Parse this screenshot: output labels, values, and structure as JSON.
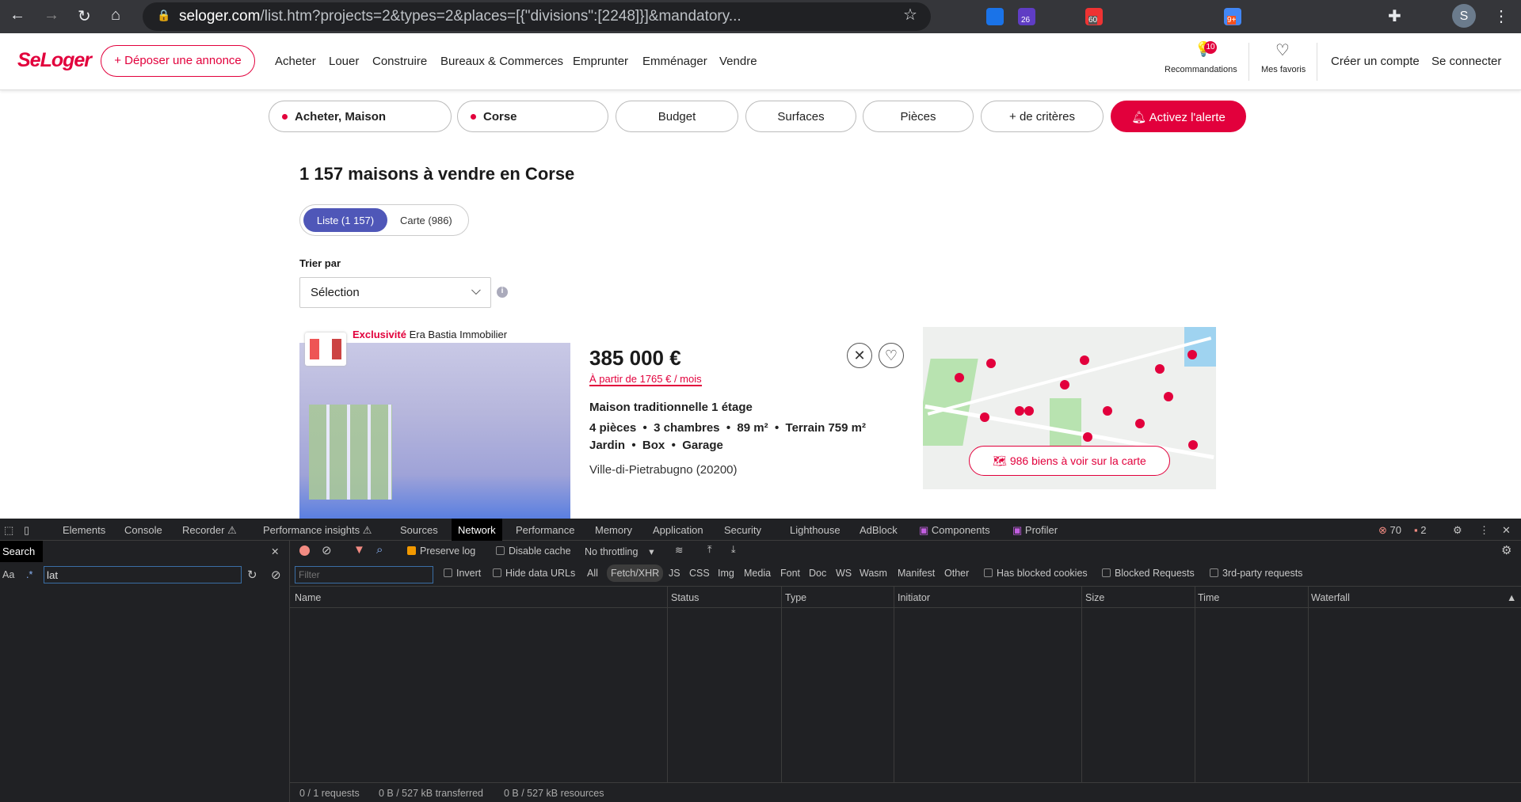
{
  "browser": {
    "url_host": "seloger.com",
    "url_path": "/list.htm?projects=2&types=2&places=[{\"divisions\":[2248]}]&mandatory...",
    "ext_badges": [
      "26",
      "60",
      "9+"
    ],
    "profile_initial": "S"
  },
  "header": {
    "logo": "SeLoger",
    "post_ad": "Déposer une annonce",
    "nav": [
      "Acheter",
      "Louer",
      "Construire",
      "Bureaux & Commerces",
      "Emprunter",
      "Emménager",
      "Vendre"
    ],
    "recommendations": "Recommandations",
    "recommendations_badge": "10",
    "favorites": "Mes favoris",
    "create_account": "Créer un compte",
    "login": "Se connecter"
  },
  "filters": {
    "project": "Acheter, Maison",
    "place": "Corse",
    "budget": "Budget",
    "surfaces": "Surfaces",
    "rooms": "Pièces",
    "more": "+ de critères",
    "alert": "Activez l'alerte"
  },
  "results": {
    "title": "1 157 maisons à vendre en Corse",
    "list_tab": "Liste (1 157)",
    "map_tab": "Carte  (986)",
    "sort_label": "Trier par",
    "sort_value": "Sélection"
  },
  "listing": {
    "exclusive": "Exclusivité",
    "agency": "Era Bastia Immobilier",
    "price": "385 000 €",
    "monthly": "À partir de 1765 € / mois",
    "title": "Maison traditionnelle 1 étage",
    "features": "4 pièces  •  3 chambres  •  89 m²  •  Terrain 759 m²",
    "extras": "Jardin  •  Box  •  Garage",
    "location": "Ville-di-Pietrabugno (20200)"
  },
  "map": {
    "button": "986 biens à voir sur la carte"
  },
  "devtools": {
    "tabs": [
      "Elements",
      "Console",
      "Recorder ⚠",
      "Performance insights ⚠",
      "Sources",
      "Network",
      "Performance",
      "Memory",
      "Application",
      "Security",
      "Lighthouse",
      "AdBlock",
      "Components",
      "Profiler"
    ],
    "errors": "70",
    "warnings": "2",
    "search_title": "Search",
    "search_value": "lat",
    "search_aa": "Aa",
    "search_regex": ".*",
    "preserve_log": "Preserve log",
    "disable_cache": "Disable cache",
    "throttling": "No throttling",
    "filter_placeholder": "Filter",
    "invert": "Invert",
    "hide_data_urls": "Hide data URLs",
    "types": [
      "All",
      "Fetch/XHR",
      "JS",
      "CSS",
      "Img",
      "Media",
      "Font",
      "Doc",
      "WS",
      "Wasm",
      "Manifest",
      "Other"
    ],
    "has_blocked_cookies": "Has blocked cookies",
    "blocked_requests": "Blocked Requests",
    "third_party": "3rd-party requests",
    "columns": [
      "Name",
      "Status",
      "Type",
      "Initiator",
      "Size",
      "Time",
      "Waterfall"
    ],
    "status_requests": "0 / 1 requests",
    "status_transferred": "0 B / 527 kB transferred",
    "status_resources": "0 B / 527 kB resources"
  },
  "colors": {
    "brand": "#e2003c",
    "toggle_active": "#4f57b8",
    "devtools_bg": "#202124"
  }
}
